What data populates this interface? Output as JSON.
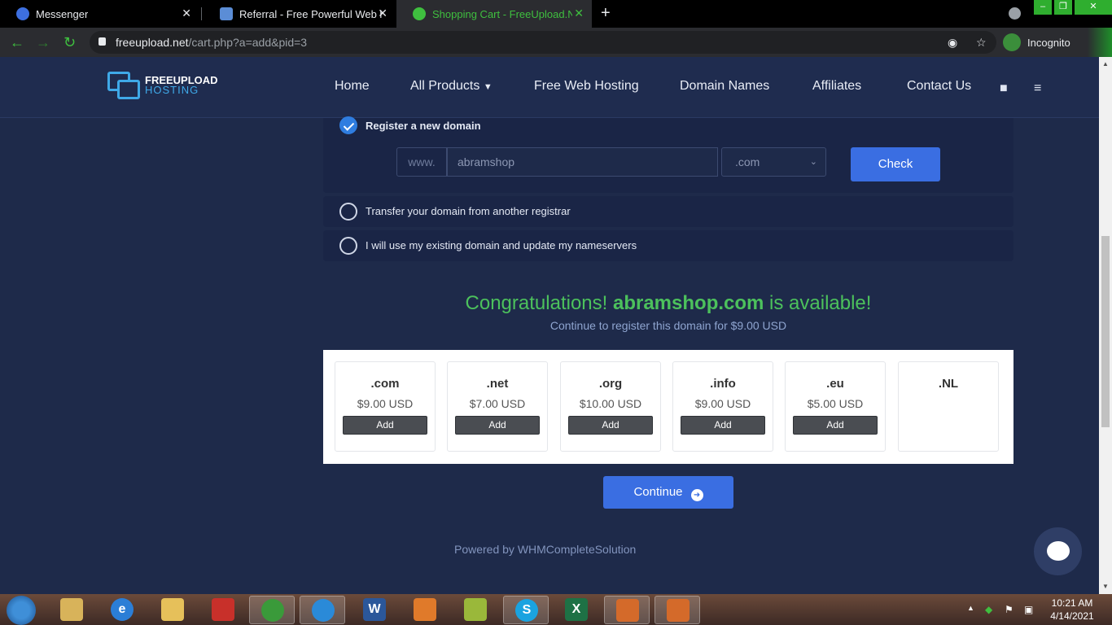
{
  "browser": {
    "tabs": [
      {
        "title": "Messenger"
      },
      {
        "title": "Referral - Free Powerful Web hos"
      },
      {
        "title": "Shopping Cart - FreeUpload.Net"
      }
    ],
    "url_host": "freeupload.net",
    "url_path": "/cart.php?a=add&pid=3",
    "profile_label": "Incognito"
  },
  "site": {
    "logo_line1": "FREEUPLOAD",
    "logo_line2": "HOSTING",
    "nav": [
      "Home",
      "All Products",
      "Free Web Hosting",
      "Domain Names",
      "Affiliates",
      "Contact Us"
    ]
  },
  "domain_options": {
    "register_label": "Register a new domain",
    "transfer_label": "Transfer your domain from another registrar",
    "existing_label": "I will use my existing domain and update my nameservers",
    "www_prefix": "www.",
    "sld_value": "abramshop",
    "tld_value": ".com",
    "check_label": "Check"
  },
  "result": {
    "congrats_prefix": "Congratulations!",
    "domain": "abramshop.com",
    "congrats_suffix": "is available!",
    "continue_text": "Continue to register this domain for $9.00 USD"
  },
  "suggestions": [
    {
      "tld": ".com",
      "price": "$9.00 USD",
      "add": "Add"
    },
    {
      "tld": ".net",
      "price": "$7.00 USD",
      "add": "Add"
    },
    {
      "tld": ".org",
      "price": "$10.00 USD",
      "add": "Add"
    },
    {
      "tld": ".info",
      "price": "$9.00 USD",
      "add": "Add"
    },
    {
      "tld": ".eu",
      "price": "$5.00 USD",
      "add": "Add"
    },
    {
      "tld": ".NL",
      "price": "",
      "add": ""
    }
  ],
  "continue_button": "Continue",
  "powered_by": "Powered by WHMCompleteSolution",
  "taskbar": {
    "time": "10:21 AM",
    "date": "4/14/2021"
  },
  "colors": {
    "accent_blue": "#3a6ee2",
    "success_green": "#4cc15c",
    "page_bg": "#1e2a4a"
  }
}
